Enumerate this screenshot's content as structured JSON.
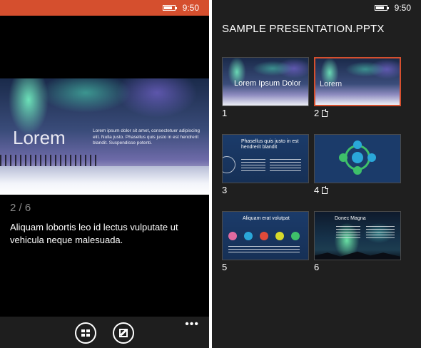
{
  "status": {
    "time": "9:50",
    "battery_level": 0.7
  },
  "left": {
    "slide": {
      "title": "Lorem",
      "body": "Lorem ipsum dolor sit amet, consectetuer adipiscing elit. Nulla justo. Phasellus quis justo in est hendrerit blandit. Suspendisse potenti."
    },
    "slide_counter": "2 / 6",
    "notes": "Aliquam lobortis leo id lectus vulputate ut vehicula neque malesuada.",
    "more_label": "•••"
  },
  "right": {
    "title": "SAMPLE PRESENTATION.PPTX",
    "thumbnails": [
      {
        "number": "1",
        "title": "Lorem Ipsum Dolor",
        "has_note": false,
        "selected": false
      },
      {
        "number": "2",
        "title": "Lorem",
        "has_note": true,
        "selected": true
      },
      {
        "number": "3",
        "title": "Phasellus quis justo in est hendrerit blandit",
        "has_note": false,
        "selected": false
      },
      {
        "number": "4",
        "title": "",
        "has_note": true,
        "selected": false
      },
      {
        "number": "5",
        "title": "Aliquam erat volutpat",
        "has_note": false,
        "selected": false
      },
      {
        "number": "6",
        "title": "Donec Magna",
        "has_note": false,
        "selected": false
      }
    ]
  },
  "colors": {
    "accent": "#d54f2e",
    "slide_navy": "#1b3b6a",
    "pane_bg": "#1f1f1f"
  },
  "icons": {
    "slides_button": "grid-icon",
    "edit_button": "edit-icon",
    "note": "document-icon"
  }
}
